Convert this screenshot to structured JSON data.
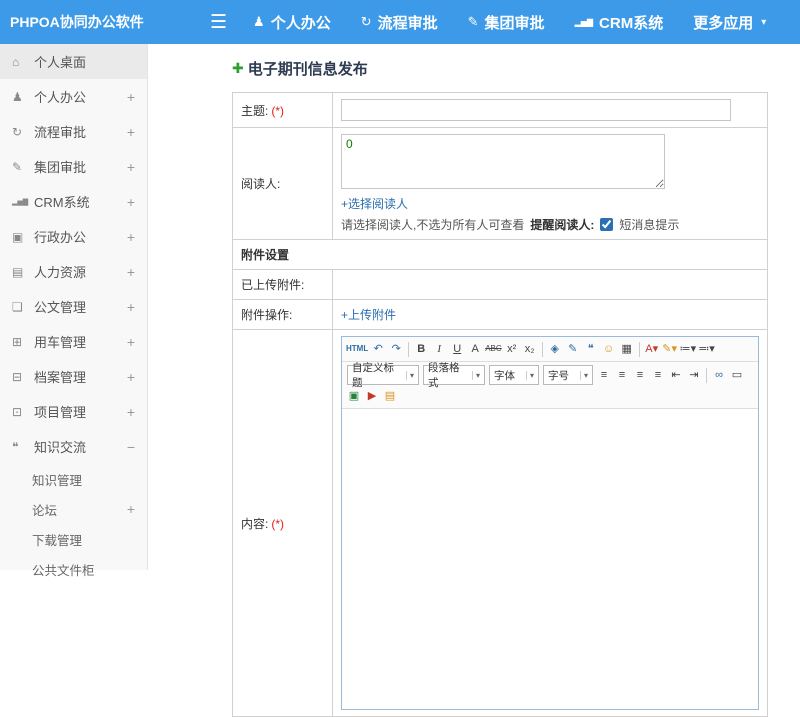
{
  "topbar": {
    "brand": "PHPOA协同办公软件",
    "menu_icon": "☰",
    "caret": "▾",
    "nav": [
      {
        "label": "个人办公",
        "glyph": "♟"
      },
      {
        "label": "流程审批",
        "glyph": "↻"
      },
      {
        "label": "集团审批",
        "glyph": "✎"
      },
      {
        "label": "CRM系统",
        "glyph": "▂▅▇"
      },
      {
        "label": "更多应用",
        "glyph": ""
      }
    ]
  },
  "sidebar": {
    "items": [
      {
        "label": "个人桌面",
        "glyph": "⌂",
        "expand": ""
      },
      {
        "label": "个人办公",
        "glyph": "♟",
        "expand": "+"
      },
      {
        "label": "流程审批",
        "glyph": "↻",
        "expand": "+"
      },
      {
        "label": "集团审批",
        "glyph": "✎",
        "expand": "+"
      },
      {
        "label": "CRM系统",
        "glyph": "▂▅▇",
        "expand": "+"
      },
      {
        "label": "行政办公",
        "glyph": "▣",
        "expand": "+"
      },
      {
        "label": "人力资源",
        "glyph": "▤",
        "expand": "+"
      },
      {
        "label": "公文管理",
        "glyph": "❏",
        "expand": "+"
      },
      {
        "label": "用车管理",
        "glyph": "⊞",
        "expand": "+"
      },
      {
        "label": "档案管理",
        "glyph": "⊟",
        "expand": "+"
      },
      {
        "label": "项目管理",
        "glyph": "⊡",
        "expand": "+"
      },
      {
        "label": "知识交流",
        "glyph": "❝",
        "expand": "−"
      }
    ],
    "subitems": [
      {
        "label": "知识管理",
        "expand": ""
      },
      {
        "label": "论坛",
        "expand": "+"
      },
      {
        "label": "下载管理",
        "expand": ""
      },
      {
        "label": "公共文件柜",
        "expand": ""
      }
    ]
  },
  "main": {
    "title_plus": "✚",
    "page_title": "电子期刊信息发布",
    "form": {
      "subject_label": "主题:",
      "required_mark": "(*)",
      "readers_label": "阅读人:",
      "readers_value": "0",
      "select_readers_link": "+选择阅读人",
      "readers_hint": "请选择阅读人,不选为所有人可查看",
      "remind_label": "提醒阅读人:",
      "sms_label": "短消息提示",
      "attachment_section_title": "附件设置",
      "uploaded_label": "已上传附件:",
      "operation_label": "附件操作:",
      "upload_link": "+上传附件",
      "content_label": "内容:"
    },
    "editor": {
      "heading_select": "自定义标题",
      "paragraph_select": "段落格式",
      "font_select": "字体",
      "size_select": "字号",
      "select_caret": "▾",
      "toolbar1": [
        {
          "name": "html-source",
          "glyph": "HTML",
          "cls": "html"
        },
        {
          "name": "undo",
          "glyph": "↶",
          "cls": "c-blue"
        },
        {
          "name": "redo",
          "glyph": "↷",
          "cls": "c-blue"
        },
        {
          "name": "sep",
          "glyph": "|"
        },
        {
          "name": "bold",
          "glyph": "B",
          "cls": "b"
        },
        {
          "name": "italic",
          "glyph": "I",
          "cls": "i"
        },
        {
          "name": "underline",
          "glyph": "U",
          "cls": "u"
        },
        {
          "name": "font-style",
          "glyph": "A"
        },
        {
          "name": "strikethrough",
          "glyph": "ABC",
          "cls": "strike"
        },
        {
          "name": "superscript",
          "glyph": "x²"
        },
        {
          "name": "subscript",
          "glyph": "x₂"
        },
        {
          "name": "sep",
          "glyph": "|"
        },
        {
          "name": "remove-format",
          "glyph": "◈",
          "cls": "c-blue"
        },
        {
          "name": "format-painter",
          "glyph": "✎",
          "cls": "c-blue"
        },
        {
          "name": "blockquote",
          "glyph": "❝",
          "cls": "c-blue"
        },
        {
          "name": "emotion",
          "glyph": "☺",
          "cls": "c-orange"
        },
        {
          "name": "table",
          "glyph": "▦"
        },
        {
          "name": "sep",
          "glyph": "|"
        },
        {
          "name": "font-color",
          "glyph": "A▾",
          "cls": "c-red"
        },
        {
          "name": "highlight-color",
          "glyph": "✎▾",
          "cls": "c-orange"
        },
        {
          "name": "ordered-list",
          "glyph": "≔▾"
        },
        {
          "name": "unordered-list",
          "glyph": "≕▾"
        }
      ],
      "toolbar2": [
        {
          "name": "align-left",
          "glyph": "≡"
        },
        {
          "name": "align-center",
          "glyph": "≡"
        },
        {
          "name": "align-right",
          "glyph": "≡"
        },
        {
          "name": "align-justify",
          "glyph": "≡"
        },
        {
          "name": "indent-decrease",
          "glyph": "⇤"
        },
        {
          "name": "indent-increase",
          "glyph": "⇥"
        },
        {
          "name": "sep",
          "glyph": "|"
        },
        {
          "name": "link",
          "glyph": "∞",
          "cls": "c-blue"
        },
        {
          "name": "horizontal-rule",
          "glyph": "▭"
        },
        {
          "name": "insert-image",
          "glyph": "▣",
          "cls": "c-green"
        },
        {
          "name": "insert-media",
          "glyph": "▶",
          "cls": "c-red"
        },
        {
          "name": "attachment",
          "glyph": "▤",
          "cls": "c-orange"
        }
      ]
    }
  }
}
